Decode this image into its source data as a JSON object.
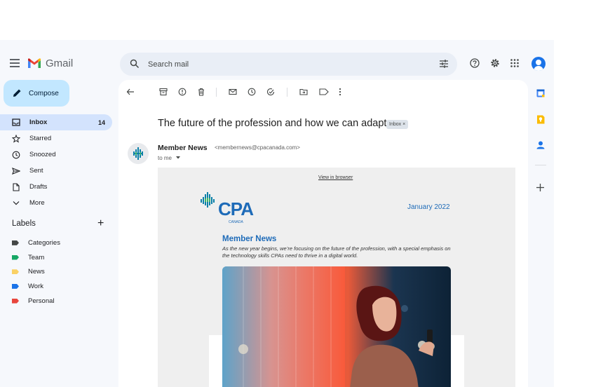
{
  "app": {
    "name": "Gmail"
  },
  "search": {
    "placeholder": "Search mail"
  },
  "compose": {
    "label": "Compose"
  },
  "nav": [
    {
      "label": "Inbox",
      "count": "14",
      "icon": "inbox-icon"
    },
    {
      "label": "Starred",
      "icon": "star-icon"
    },
    {
      "label": "Snoozed",
      "icon": "clock-icon"
    },
    {
      "label": "Sent",
      "icon": "send-icon"
    },
    {
      "label": "Drafts",
      "icon": "draft-icon"
    },
    {
      "label": "More",
      "icon": "chevron-down-icon"
    }
  ],
  "labels": {
    "title": "Labels",
    "items": [
      {
        "label": "Categories",
        "color": "#444746"
      },
      {
        "label": "Team",
        "color": "#16a765"
      },
      {
        "label": "News",
        "color": "#fad165"
      },
      {
        "label": "Work",
        "color": "#1a73e8"
      },
      {
        "label": "Personal",
        "color": "#e8453c"
      }
    ]
  },
  "email": {
    "subject": "The future of the profession and how we can adapt",
    "chip": "Inbox ×",
    "sender_name": "Member News",
    "sender_email": "<membernews@cpacanada.com>",
    "recipient": "to me"
  },
  "newsletter": {
    "view_in_browser": "View in browser",
    "brand": "CPA",
    "brand_sub": "CANADA",
    "date": "January 2022",
    "title": "Member News",
    "description": "As the new year begins, we’re focusing on the future of the profession, with a special emphasis on the technology skills CPAs need to thrive in a digital world."
  },
  "colors": {
    "accent": "#1a73e8",
    "cpa_blue": "#1e6bb8",
    "compose_bg": "#c2e7ff",
    "active_nav": "#d3e3fd",
    "app_bg": "#f6f8fc"
  }
}
